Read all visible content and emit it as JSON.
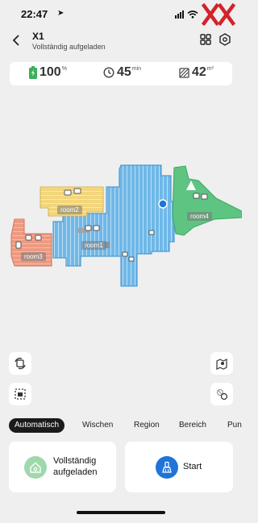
{
  "status_bar": {
    "time": "22:47",
    "location_glyph": "➤",
    "brand": "XX"
  },
  "header": {
    "title": "X1",
    "subtitle": "Vollständig aufgeladen"
  },
  "stats": {
    "battery": {
      "value": "100",
      "unit": "%",
      "level_percent": 100
    },
    "duration": {
      "value": "45",
      "unit": "min"
    },
    "area": {
      "value": "42",
      "unit": "m²"
    }
  },
  "map": {
    "rooms": [
      {
        "label": "room2",
        "color": "#f3d67b"
      },
      {
        "label": "room1",
        "color": "#6fb8e8"
      },
      {
        "label": "room4",
        "color": "#5ec482"
      },
      {
        "label": "room3",
        "color": "#ee9980"
      }
    ]
  },
  "tabs": [
    "Automatisch",
    "Wischen",
    "Region",
    "Bereich",
    "Pun"
  ],
  "actions": {
    "left": {
      "line1": "Vollständig",
      "line2": "aufgeladen",
      "color": "#9fd8ab"
    },
    "right": {
      "label": "Start",
      "color": "#1f74d8"
    }
  },
  "colors": {
    "accent": "#1f74d8",
    "battery_green": "#3cb05b",
    "brand_red": "#d3232a"
  }
}
